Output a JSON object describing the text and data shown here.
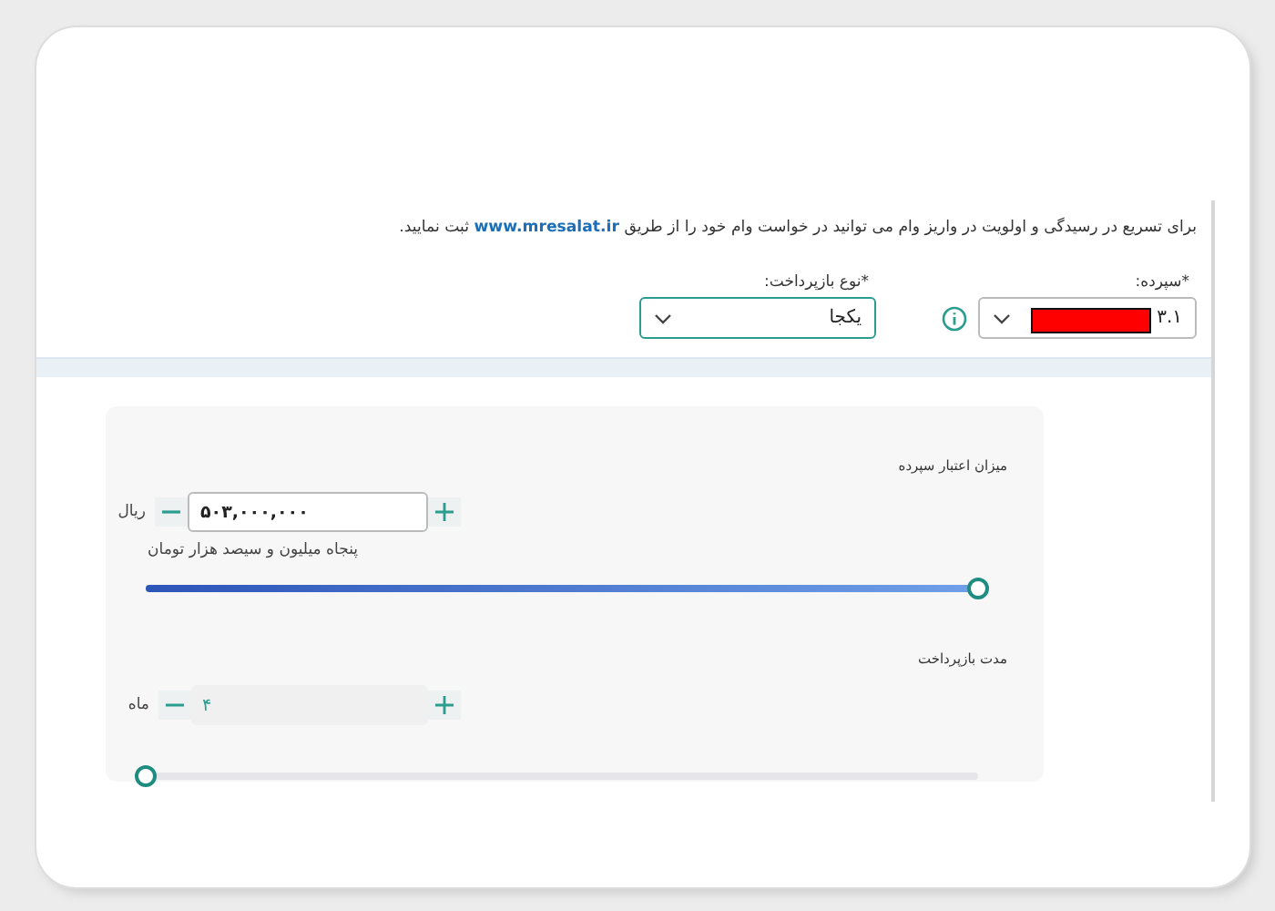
{
  "notice": {
    "text_before": "برای تسریع در رسیدگی و اولویت در واریز وام می توانید در خواست وام خود را از طریق",
    "link": "www.mresalat.ir",
    "text_after": "ثبت نمایید."
  },
  "deposit": {
    "label": "*سپرده:",
    "value": "۳.۱",
    "redacted": true
  },
  "repayment_type": {
    "label": "*نوع بازپرداخت:",
    "value": "یکجا"
  },
  "sliders": [
    {
      "label": "میزان اعتبار سپرده",
      "value": "۵۰۳,۰۰۰,۰۰۰",
      "unit": "ریال",
      "caption": "پنجاه میلیون و سیصد هزار تومان",
      "level": 1,
      "disabled": false
    },
    {
      "label": "مدت بازپرداخت",
      "value": "۴",
      "unit": "ماه",
      "level": 0,
      "disabled": true
    }
  ]
}
